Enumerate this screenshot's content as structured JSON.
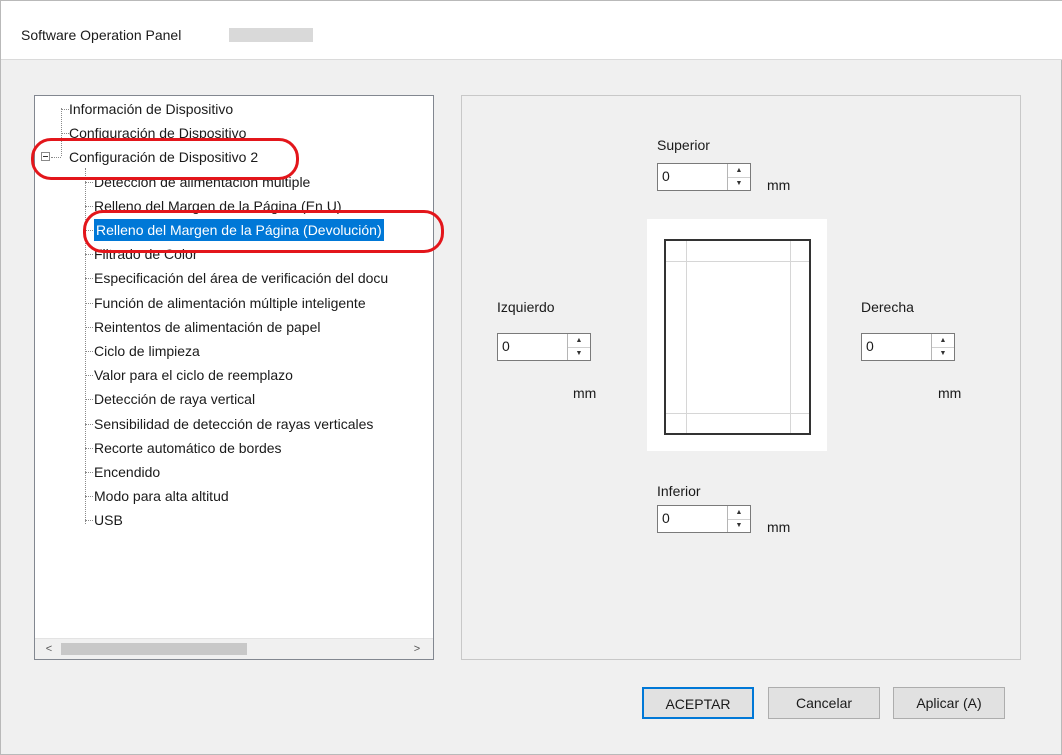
{
  "window": {
    "title": "Software Operation Panel"
  },
  "tree": {
    "items": [
      {
        "label": "Información de Dispositivo",
        "level": 0
      },
      {
        "label": "Configuración de Dispositivo",
        "level": 0
      },
      {
        "label": "Configuración de Dispositivo 2",
        "level": 0,
        "expanded": true
      },
      {
        "label": "Detección de alimentación múltiple",
        "level": 1
      },
      {
        "label": "Relleno del Margen de la Página (En U)",
        "level": 1
      },
      {
        "label": "Relleno del Margen de la Página (Devolución)",
        "level": 1,
        "selected": true
      },
      {
        "label": "Filtrado de Color",
        "level": 1
      },
      {
        "label": "Especificación del área de verificación del docu",
        "level": 1
      },
      {
        "label": "Función de alimentación múltiple inteligente",
        "level": 1
      },
      {
        "label": "Reintentos de alimentación de papel",
        "level": 1
      },
      {
        "label": "Ciclo de limpieza",
        "level": 1
      },
      {
        "label": "Valor para el ciclo de reemplazo",
        "level": 1
      },
      {
        "label": "Detección de raya vertical",
        "level": 1
      },
      {
        "label": "Sensibilidad de detección de rayas verticales",
        "level": 1
      },
      {
        "label": "Recorte automático de bordes",
        "level": 1
      },
      {
        "label": "Encendido",
        "level": 1
      },
      {
        "label": "Modo para alta altitud",
        "level": 1
      },
      {
        "label": "USB",
        "level": 1
      }
    ],
    "scroll_left_glyph": "<",
    "scroll_right_glyph": ">"
  },
  "margins": {
    "top": {
      "label": "Superior",
      "value": "0",
      "unit": "mm"
    },
    "left": {
      "label": "Izquierdo",
      "value": "0",
      "unit": "mm"
    },
    "right": {
      "label": "Derecha",
      "value": "0",
      "unit": "mm"
    },
    "bottom": {
      "label": "Inferior",
      "value": "0",
      "unit": "mm"
    }
  },
  "buttons": {
    "ok": "ACEPTAR",
    "cancel": "Cancelar",
    "apply": "Aplicar (A)"
  },
  "colors": {
    "selection": "#0078d7",
    "highlight_oval": "#e3161b"
  }
}
